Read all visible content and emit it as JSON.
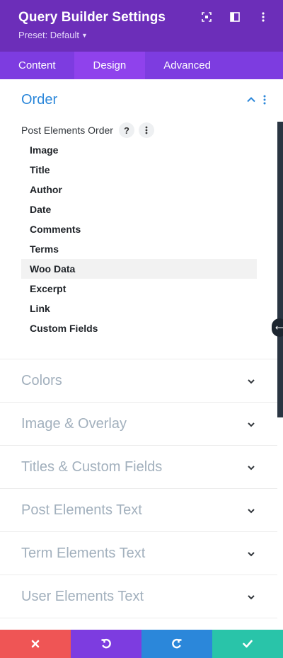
{
  "header": {
    "title": "Query Builder Settings",
    "preset": "Preset: Default",
    "icons": [
      "focus-icon",
      "split-view-icon",
      "more-vertical-icon"
    ]
  },
  "tabs": [
    {
      "label": "Content",
      "active": false
    },
    {
      "label": "Design",
      "active": true
    },
    {
      "label": "Advanced",
      "active": false
    }
  ],
  "order_section": {
    "title": "Order",
    "field_label": "Post Elements Order",
    "help_glyph": "?",
    "items": [
      "Image",
      "Title",
      "Author",
      "Date",
      "Comments",
      "Terms",
      "Woo Data",
      "Excerpt",
      "Link",
      "Custom Fields"
    ],
    "highlighted_item": "Woo Data"
  },
  "sections": [
    {
      "label": "Colors"
    },
    {
      "label": "Image & Overlay"
    },
    {
      "label": "Titles & Custom Fields"
    },
    {
      "label": "Post Elements Text"
    },
    {
      "label": "Term Elements Text"
    },
    {
      "label": "User Elements Text"
    }
  ],
  "bottom_bar": [
    "close-icon",
    "undo-icon",
    "redo-icon",
    "check-icon"
  ],
  "colors": {
    "header": "#6c2eb9",
    "tabs": "#7d3ce0",
    "active_tab": "#8f42ec",
    "accent_blue": "#2b87da",
    "cancel": "#ef5555",
    "undo": "#7d3ce0",
    "redo": "#2b87da",
    "save": "#29c4a9"
  }
}
